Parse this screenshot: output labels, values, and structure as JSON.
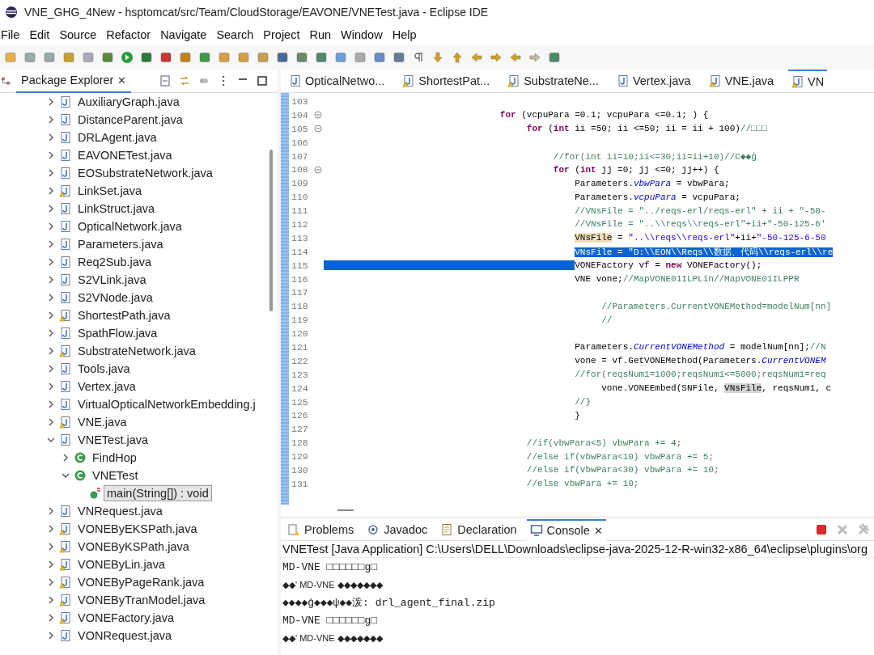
{
  "window": {
    "title": "VNE_GHG_4New - hsptomcat/src/Team/CloudStorage/EAVONE/VNETest.java - Eclipse IDE"
  },
  "menu": [
    "File",
    "Edit",
    "Source",
    "Refactor",
    "Navigate",
    "Search",
    "Project",
    "Run",
    "Window",
    "Help"
  ],
  "explorer": {
    "title": "Package Explorer",
    "close": "✕",
    "items": [
      {
        "label": "AuxiliaryGraph.java",
        "kind": "java",
        "warning": false,
        "expanded": false,
        "selected": false
      },
      {
        "label": "DistanceParent.java",
        "kind": "java",
        "warning": false,
        "expanded": false,
        "selected": false
      },
      {
        "label": "DRLAgent.java",
        "kind": "java",
        "warning": false,
        "expanded": false,
        "selected": false
      },
      {
        "label": "EAVONETest.java",
        "kind": "java",
        "warning": false,
        "expanded": false,
        "selected": false
      },
      {
        "label": "EOSubstrateNetwork.java",
        "kind": "java",
        "warning": false,
        "expanded": false,
        "selected": false
      },
      {
        "label": "LinkSet.java",
        "kind": "java",
        "warning": true,
        "expanded": false,
        "selected": false
      },
      {
        "label": "LinkStruct.java",
        "kind": "java",
        "warning": false,
        "expanded": false,
        "selected": false
      },
      {
        "label": "OpticalNetwork.java",
        "kind": "java",
        "warning": false,
        "expanded": false,
        "selected": false
      },
      {
        "label": "Parameters.java",
        "kind": "java",
        "warning": false,
        "expanded": false,
        "selected": false
      },
      {
        "label": "Req2Sub.java",
        "kind": "java",
        "warning": false,
        "expanded": false,
        "selected": false
      },
      {
        "label": "S2VLink.java",
        "kind": "java",
        "warning": false,
        "expanded": false,
        "selected": false
      },
      {
        "label": "S2VNode.java",
        "kind": "java",
        "warning": false,
        "expanded": false,
        "selected": false
      },
      {
        "label": "ShortestPath.java",
        "kind": "java",
        "warning": true,
        "expanded": false,
        "selected": false
      },
      {
        "label": "SpathFlow.java",
        "kind": "java",
        "warning": false,
        "expanded": false,
        "selected": false
      },
      {
        "label": "SubstrateNetwork.java",
        "kind": "java",
        "warning": true,
        "expanded": false,
        "selected": false
      },
      {
        "label": "Tools.java",
        "kind": "java",
        "warning": false,
        "expanded": false,
        "selected": false
      },
      {
        "label": "Vertex.java",
        "kind": "java",
        "warning": false,
        "expanded": false,
        "selected": false
      },
      {
        "label": "VirtualOpticalNetworkEmbedding.j",
        "kind": "java",
        "warning": false,
        "expanded": false,
        "selected": false
      },
      {
        "label": "VNE.java",
        "kind": "java",
        "warning": true,
        "expanded": false,
        "selected": false
      },
      {
        "label": "VNETest.java",
        "kind": "java",
        "warning": false,
        "expanded": true,
        "selected": false,
        "children": [
          {
            "label": "FindHop",
            "kind": "class",
            "expanded": false,
            "selected": false
          },
          {
            "label": "VNETest",
            "kind": "class",
            "expanded": true,
            "selected": false,
            "children": [
              {
                "label": "main(String[]) : void",
                "kind": "method",
                "selected": true
              }
            ]
          }
        ]
      },
      {
        "label": "VNRequest.java",
        "kind": "java",
        "warning": false,
        "expanded": false,
        "selected": false
      },
      {
        "label": "VONEByEKSPath.java",
        "kind": "java",
        "warning": true,
        "expanded": false,
        "selected": false
      },
      {
        "label": "VONEByKSPath.java",
        "kind": "java",
        "warning": true,
        "expanded": false,
        "selected": false
      },
      {
        "label": "VONEByLin.java",
        "kind": "java",
        "warning": true,
        "expanded": false,
        "selected": false
      },
      {
        "label": "VONEByPageRank.java",
        "kind": "java",
        "warning": true,
        "expanded": false,
        "selected": false
      },
      {
        "label": "VONEByTranModel.java",
        "kind": "java",
        "warning": true,
        "expanded": false,
        "selected": false
      },
      {
        "label": "VONEFactory.java",
        "kind": "java",
        "warning": true,
        "expanded": false,
        "selected": false
      },
      {
        "label": "VONRequest.java",
        "kind": "java",
        "warning": false,
        "expanded": false,
        "selected": false
      }
    ]
  },
  "editor_tabs": [
    {
      "label": "OpticalNetwo...",
      "warning": false,
      "selected": false
    },
    {
      "label": "ShortestPat...",
      "warning": true,
      "selected": false
    },
    {
      "label": "SubstrateNe...",
      "warning": true,
      "selected": false
    },
    {
      "label": "Vertex.java",
      "warning": false,
      "selected": false
    },
    {
      "label": "VNE.java",
      "warning": true,
      "selected": false
    },
    {
      "label": "VN",
      "warning": true,
      "selected": true
    }
  ],
  "code": [
    {
      "number": "103",
      "foldable": false
    },
    {
      "number": "104",
      "foldable": true,
      "segments": [
        {
          "kind": "keyword",
          "text": "                                 for"
        },
        {
          "kind": "code",
          "text": " (vcpuPara =0.1; vcpuPara <=0.1; ) {"
        }
      ]
    },
    {
      "number": "105",
      "foldable": true,
      "segments": [
        {
          "kind": "keyword",
          "text": "                                      for"
        },
        {
          "kind": "code",
          "text": " ("
        },
        {
          "kind": "keyword",
          "text": "int"
        },
        {
          "kind": "code",
          "text": " ii =50; ii <=50; ii = ii + 100)"
        },
        {
          "kind": "comment",
          "text": "//□□□"
        }
      ]
    },
    {
      "number": "106",
      "foldable": false
    },
    {
      "number": "107",
      "foldable": false,
      "segments": [
        {
          "kind": "comment",
          "text": "                                           //for(int ii=10;ii<=30;ii=ii+10)//C◆◆ģ"
        }
      ]
    },
    {
      "number": "108",
      "foldable": true,
      "segments": [
        {
          "kind": "keyword",
          "text": "                                           for"
        },
        {
          "kind": "code",
          "text": " ("
        },
        {
          "kind": "keyword",
          "text": "int"
        },
        {
          "kind": "code",
          "text": " jj =0; jj <=0; jj++) {"
        }
      ]
    },
    {
      "number": "109",
      "foldable": false,
      "segments": [
        {
          "kind": "code",
          "text": "                                               Parameters."
        },
        {
          "kind": "field",
          "text": "vbwPara"
        },
        {
          "kind": "code",
          "text": " = vbwPara;"
        }
      ]
    },
    {
      "number": "110",
      "foldable": false,
      "segments": [
        {
          "kind": "code",
          "text": "                                               Parameters."
        },
        {
          "kind": "field",
          "text": "vcpuPara"
        },
        {
          "kind": "code",
          "text": " = vcpuPara;"
        }
      ]
    },
    {
      "number": "111",
      "foldable": false,
      "segments": [
        {
          "kind": "comment",
          "text": "                                               //VNsFile = \"../reqs-erl/reqs-erl\" + ii + \"-50-"
        }
      ]
    },
    {
      "number": "112",
      "foldable": false,
      "segments": [
        {
          "kind": "comment",
          "text": "                                               //VNsFile = \"..\\\\reqs\\\\reqs-erl\"+ii+\"-50-125-6'"
        }
      ]
    },
    {
      "number": "113",
      "foldable": false,
      "segments": [
        {
          "kind": "mark",
          "text": "                                               VNsFile"
        },
        {
          "kind": "code",
          "text": " = "
        },
        {
          "kind": "string",
          "text": "\"..\\\\reqs\\\\reqs-erl\""
        },
        {
          "kind": "code",
          "text": "+ii+"
        },
        {
          "kind": "string",
          "text": "\"-50-125-6-50"
        }
      ]
    },
    {
      "number": "114",
      "foldable": false,
      "segments": [
        {
          "kind": "selection",
          "text": "                                               VNsFile = \"D:\\\\EON\\\\Reqs\\\\数据、代码\\\\reqs-erl\\\\re"
        }
      ]
    },
    {
      "number": "115",
      "foldable": false,
      "indent_selected": true,
      "segments": [
        {
          "kind": "code",
          "text": "                                               VONEFactory vf = "
        },
        {
          "kind": "keyword",
          "text": "new"
        },
        {
          "kind": "code",
          "text": " VONEFactory();"
        }
      ]
    },
    {
      "number": "116",
      "foldable": false,
      "segments": [
        {
          "kind": "code",
          "text": "                                               VNE vone;"
        },
        {
          "kind": "comment",
          "text": "//MapVONE01ILPLin//MapVONE01ILPPR"
        }
      ]
    },
    {
      "number": "117",
      "foldable": false
    },
    {
      "number": "118",
      "foldable": false,
      "segments": [
        {
          "kind": "comment",
          "text": "                                                    //Parameters.CurrentVONEMethod=modelNum[nn]"
        }
      ]
    },
    {
      "number": "119",
      "foldable": false,
      "segments": [
        {
          "kind": "comment",
          "text": "                                                    //"
        }
      ]
    },
    {
      "number": "120",
      "foldable": false
    },
    {
      "number": "121",
      "foldable": false,
      "segments": [
        {
          "kind": "code",
          "text": "                                               Parameters."
        },
        {
          "kind": "field",
          "text": "CurrentVONEMethod"
        },
        {
          "kind": "code",
          "text": " = modelNum[nn];"
        },
        {
          "kind": "comment",
          "text": "//N"
        }
      ]
    },
    {
      "number": "122",
      "foldable": false,
      "segments": [
        {
          "kind": "code",
          "text": "                                               vone = vf.GetVONEMethod(Parameters."
        },
        {
          "kind": "field",
          "text": "CurrentVONEM"
        }
      ]
    },
    {
      "number": "123",
      "foldable": false,
      "segments": [
        {
          "kind": "comment",
          "text": "                                               //for(reqsNum1=1000;reqsNum1<=5000;reqsNum1=req"
        }
      ]
    },
    {
      "number": "124",
      "foldable": false,
      "segments": [
        {
          "kind": "code",
          "text": "                                                    vone.VONEEmbed(SNFile, "
        },
        {
          "kind": "occurrence",
          "text": "VNsFile"
        },
        {
          "kind": "code",
          "text": ", reqsNum1, c"
        }
      ]
    },
    {
      "number": "125",
      "foldable": false,
      "segments": [
        {
          "kind": "comment",
          "text": "                                               //}"
        }
      ]
    },
    {
      "number": "126",
      "foldable": false,
      "segments": [
        {
          "kind": "code",
          "text": "                                               }"
        }
      ]
    },
    {
      "number": "127",
      "foldable": false
    },
    {
      "number": "128",
      "foldable": false,
      "segments": [
        {
          "kind": "comment",
          "text": "                                      //if(vbwPara<5) vbwPara += 4;"
        }
      ]
    },
    {
      "number": "129",
      "foldable": false,
      "segments": [
        {
          "kind": "comment",
          "text": "                                      //else if(vbwPara<10) vbwPara += 5;"
        }
      ]
    },
    {
      "number": "130",
      "foldable": false,
      "segments": [
        {
          "kind": "comment",
          "text": "                                      //else if(vbwPara<30) vbwPara += 10;"
        }
      ]
    },
    {
      "number": "131",
      "foldable": false,
      "segments": [
        {
          "kind": "comment",
          "text": "                                      //else vbwPara += 10;"
        }
      ]
    }
  ],
  "bottom_tabs": [
    {
      "label": "Problems",
      "kind": "problems",
      "selected": false
    },
    {
      "label": "Javadoc",
      "kind": "javadoc",
      "selected": false
    },
    {
      "label": "Declaration",
      "kind": "declaration",
      "selected": false
    },
    {
      "label": "Console",
      "kind": "console",
      "selected": true,
      "close": "✕"
    }
  ],
  "console": {
    "header": "VNETest [Java Application] C:\\Users\\DELL\\Downloads\\eclipse-java-2025-12-R-win32-x86_64\\eclipse\\plugins\\org",
    "lines": [
      {
        "text": "MD-VNE □□□□□□g□",
        "kind": "mono"
      },
      {
        "text": "◆◆' MD-VNE ◆◆◆◆◆◆◆",
        "kind": "sans"
      },
      {
        "text": "◆◆◆◆ģ◆◆◆ψ◆◆泼: drl_agent_final.zip",
        "kind": "mono"
      },
      {
        "text": "MD-VNE □□□□□□g□",
        "kind": "mono"
      },
      {
        "text": "◆◆' MD-VNE ◆◆◆◆◆◆◆",
        "kind": "sans"
      }
    ]
  }
}
